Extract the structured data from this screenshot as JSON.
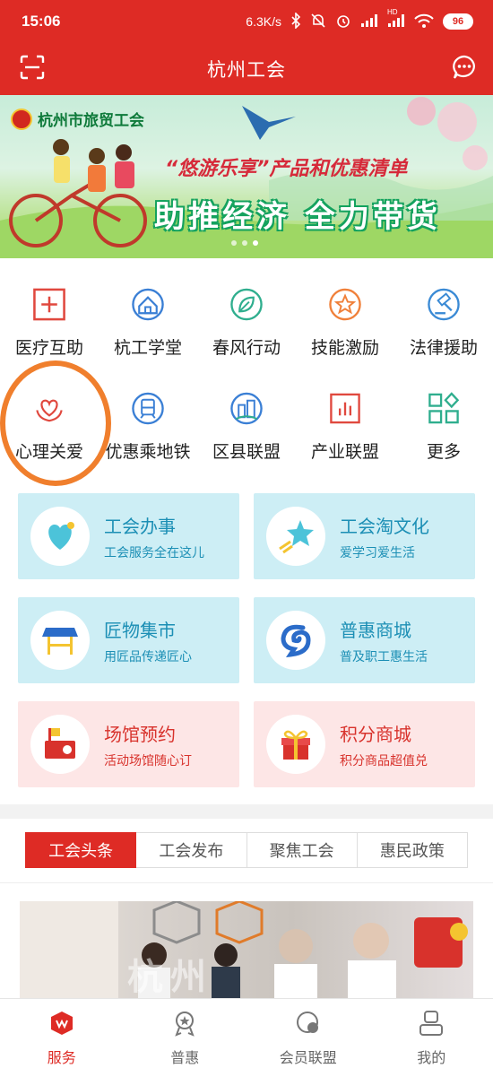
{
  "status_bar": {
    "time": "15:06",
    "network_speed": "6.3K/s",
    "battery": "96",
    "network_label": "HD"
  },
  "header": {
    "title": "杭州工会",
    "scan_icon": "scan-icon",
    "message_icon": "chat-bubble-icon"
  },
  "banner": {
    "org": "杭州市旅贸工会",
    "subtitle": "“悠游乐享”产品和优惠清单",
    "headline": "助推经济 全力带货",
    "slide_count": 3,
    "active_slide": 3
  },
  "grid": [
    {
      "label": "医疗互助",
      "icon": "medical-cross-icon",
      "color": "#e0483e"
    },
    {
      "label": "杭工学堂",
      "icon": "school-house-icon",
      "color": "#3a7fd5"
    },
    {
      "label": "春风行动",
      "icon": "leaf-icon",
      "color": "#2fae8e"
    },
    {
      "label": "技能激励",
      "icon": "star-badge-icon",
      "color": "#f0803a"
    },
    {
      "label": "法律援助",
      "icon": "gavel-icon",
      "color": "#3a8ad5"
    },
    {
      "label": "心理关爱",
      "icon": "heart-hands-icon",
      "color": "#e0483e"
    },
    {
      "label": "优惠乘地铁",
      "icon": "metro-train-icon",
      "color": "#3a7fd5"
    },
    {
      "label": "区县联盟",
      "icon": "city-alliance-icon",
      "color": "#3a7fd5"
    },
    {
      "label": "产业联盟",
      "icon": "bar-chart-icon",
      "color": "#e0483e"
    },
    {
      "label": "更多",
      "icon": "more-grid-icon",
      "color": "#2fae8e"
    }
  ],
  "cards": [
    {
      "title": "工会办事",
      "desc": "工会服务全在这儿",
      "icon": "heart-icon",
      "theme": "blue"
    },
    {
      "title": "工会淘文化",
      "desc": "爱学习爱生活",
      "icon": "shooting-star-icon",
      "theme": "blue"
    },
    {
      "title": "匠物集市",
      "desc": "用匠品传递匠心",
      "icon": "market-stall-icon",
      "theme": "blue"
    },
    {
      "title": "普惠商城",
      "desc": "普及职工惠生活",
      "icon": "mall-logo-icon",
      "theme": "blue"
    },
    {
      "title": "场馆预约",
      "desc": "活动场馆随心订",
      "icon": "venue-flag-icon",
      "theme": "pink"
    },
    {
      "title": "积分商城",
      "desc": "积分商品超值兑",
      "icon": "gift-box-icon",
      "theme": "pink"
    }
  ],
  "tabs": [
    {
      "label": "工会头条",
      "active": true
    },
    {
      "label": "工会发布",
      "active": false
    },
    {
      "label": "聚焦工会",
      "active": false
    },
    {
      "label": "惠民政策",
      "active": false
    }
  ],
  "news": {
    "watermark": "杭州"
  },
  "bottom_nav": [
    {
      "label": "服务",
      "icon": "service-cube-icon",
      "active": true
    },
    {
      "label": "普惠",
      "icon": "benefit-medal-icon",
      "active": false
    },
    {
      "label": "会员联盟",
      "icon": "member-alliance-icon",
      "active": false
    },
    {
      "label": "我的",
      "icon": "profile-icon",
      "active": false
    }
  ],
  "colors": {
    "brand_red": "#de2b25",
    "highlight_orange": "#f07f2d",
    "card_blue_bg": "#cdeef5",
    "card_pink_bg": "#fde6e6"
  }
}
